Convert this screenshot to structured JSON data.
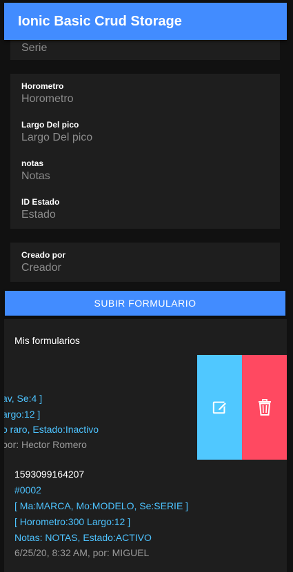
{
  "header": {
    "title": "Ionic Basic Crud Storage"
  },
  "form": {
    "serie_placeholder": "Serie",
    "horometro_label": "Horometro",
    "horometro_placeholder": "Horometro",
    "largo_label": "Largo Del pico",
    "largo_placeholder": "Largo Del pico",
    "notas_label": "notas",
    "notas_placeholder": "Notas",
    "estado_label": "ID Estado",
    "estado_placeholder": "Estado",
    "creado_label": "Creado por",
    "creado_placeholder": "Creador",
    "submit_label": "SUBIR FORMULARIO"
  },
  "list": {
    "header": "Mis formularios",
    "items": [
      {
        "line_equipment": "av, Se:4 ]",
        "line_metrics": "argo:12 ]",
        "line_notes": "o raro, Estado:Inactivo",
        "line_meta": "por: Hector Romero"
      },
      {
        "id": "1593099164207",
        "number": "#0002",
        "line_equipment": "[ Ma:MARCA, Mo:MODELO, Se:SERIE ]",
        "line_metrics": "[ Horometro:300 Largo:12 ]",
        "line_notes": "Notas: NOTAS, Estado:ACTIVO",
        "line_meta": "6/25/20, 8:32 AM, por: MIGUEL"
      }
    ]
  },
  "icons": {
    "edit": "edit-icon",
    "delete": "trash-icon"
  },
  "colors": {
    "primary": "#428cff",
    "edit": "#50c8ff",
    "delete": "#ff4961",
    "link": "#4dc3ff"
  }
}
